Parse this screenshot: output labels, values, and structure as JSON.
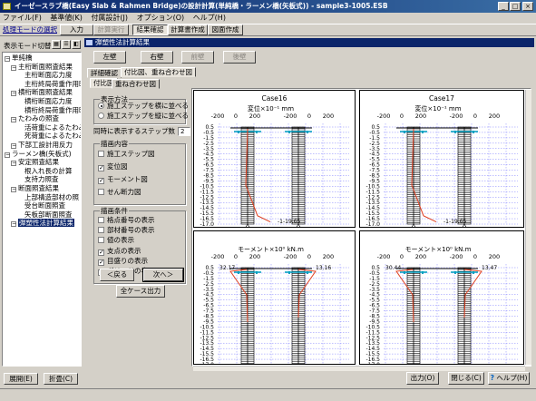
{
  "window": {
    "title": "イーゼースラブ橋(Easy Slab & Rahmen Bridge)の設計計算(単純橋・ラーメン橋(矢板式)) - sample3-1005.ESB",
    "controls": [
      "_",
      "□",
      "×"
    ]
  },
  "menu": [
    "ファイル(F)",
    "基準値(K)",
    "付属設計(J)",
    "オプション(O)",
    "ヘルプ(H)"
  ],
  "toolbar": {
    "mode_label": "処理モードの選択",
    "tabs": [
      "入力",
      "計算実行",
      "結果確認",
      "計算書作成",
      "図面作成"
    ]
  },
  "sidebar": {
    "title": "表示モード切替",
    "tree": [
      {
        "label": "単純橋",
        "indent": 0
      },
      {
        "label": "主桁断面照査結果",
        "indent": 1
      },
      {
        "label": "主桁断面応力度",
        "indent": 2
      },
      {
        "label": "主桁終局荷重作用時",
        "indent": 2
      },
      {
        "label": "横桁断面照査結果",
        "indent": 1
      },
      {
        "label": "横桁断面応力度",
        "indent": 2
      },
      {
        "label": "横桁終局荷重作用時",
        "indent": 2
      },
      {
        "label": "たわみの照査",
        "indent": 1
      },
      {
        "label": "活荷重によるたわみ",
        "indent": 2
      },
      {
        "label": "死荷重によるたわみ",
        "indent": 2
      },
      {
        "label": "下部工設計用反力",
        "indent": 1
      },
      {
        "label": "ラーメン橋(矢板式)",
        "indent": 0
      },
      {
        "label": "安定照査結果",
        "indent": 1
      },
      {
        "label": "根入れ長の計算",
        "indent": 2
      },
      {
        "label": "支持力照査",
        "indent": 2
      },
      {
        "label": "断面照査結果",
        "indent": 1
      },
      {
        "label": "上部構造部材の照",
        "indent": 2
      },
      {
        "label": "受台断面照査",
        "indent": 2
      },
      {
        "label": "矢板部断面照査",
        "indent": 2
      },
      {
        "label": "弾塑性法計算結果",
        "indent": 1
      }
    ],
    "expand_button": "展開(E)",
    "collapse_button": "折畳(C)"
  },
  "panel": {
    "title": "弾塑性法計算結果",
    "nav": {
      "left": "左壁",
      "right": "右壁",
      "prev": "前壁",
      "next": "後壁"
    },
    "tabs": [
      "詳細確認",
      "付比図、重ね合わせ図"
    ],
    "subtabs": [
      "付比図",
      "重ね合わせ図"
    ],
    "display_method": {
      "caption": "表示方法",
      "options": [
        "施工ステップを横に並べる",
        "施工ステップを縦に並べる"
      ],
      "selected": 0
    },
    "steps_label": "同時に表示するステップ数",
    "steps_value": "2",
    "draw_content": {
      "caption": "描画内容",
      "items": [
        {
          "label": "施工ステップ図",
          "checked": false
        },
        {
          "label": "変位図",
          "checked": true
        },
        {
          "label": "モーメント図",
          "checked": true
        },
        {
          "label": "せん断力図",
          "checked": false
        }
      ]
    },
    "draw_conditions": {
      "caption": "描画条件",
      "items": [
        {
          "label": "格点番号の表示",
          "checked": false
        },
        {
          "label": "部材番号の表示",
          "checked": false
        },
        {
          "label": "値の表示",
          "checked": false
        },
        {
          "label": "支点の表示",
          "checked": true
        },
        {
          "label": "目盛りの表示",
          "checked": true
        },
        {
          "label": "グリッドの表示",
          "checked": true
        }
      ]
    },
    "back_button": "＜戻る",
    "next_button": "次へ＞",
    "all_cases_button": "全ケース出力"
  },
  "chart_data": [
    {
      "type": "line",
      "case": "Case16",
      "title": "変位×10⁻¹ mm",
      "xlabel": "",
      "x_ticks": [
        "-200",
        "0",
        "200"
      ],
      "y_ticks": [
        "0.5",
        "-0.5",
        "-1.5",
        "-2.5",
        "-3.5",
        "-4.5",
        "-5.5",
        "-6.5",
        "-7.5",
        "-8.5",
        "-9.5",
        "-10.5",
        "-11.5",
        "-12.5",
        "-13.5",
        "-14.5",
        "-15.5",
        "-16.5",
        "-17.0"
      ],
      "ylim": [
        -17.0,
        0.5
      ],
      "grid": true,
      "annotations": [
        "-1-19.65"
      ],
      "series": [
        {
          "values": [
            0,
            0,
            -5,
            -10,
            -19.65
          ]
        }
      ]
    },
    {
      "type": "line",
      "case": "Case17",
      "title": "変位×10⁻¹ mm",
      "xlabel": "",
      "x_ticks": [
        "-200",
        "0",
        "200"
      ],
      "y_ticks": [
        "0.5",
        "-0.5",
        "-1.5",
        "-2.5",
        "-3.5",
        "-4.5",
        "-5.5",
        "-6.5",
        "-7.5",
        "-8.5",
        "-9.5",
        "-10.5",
        "-11.5",
        "-12.5",
        "-13.5",
        "-14.5",
        "-15.5",
        "-16.5",
        "-17.0"
      ],
      "ylim": [
        -17.0,
        0.5
      ],
      "grid": true,
      "annotations": [
        "-1-19.65"
      ],
      "series": [
        {
          "values": [
            0,
            0,
            -5,
            -10,
            -19.65
          ]
        }
      ]
    },
    {
      "type": "line",
      "case": "Case16",
      "title": "モーメント×10⁰ kN.m",
      "xlabel": "",
      "x_ticks": [
        "-200",
        "0",
        "200"
      ],
      "y_ticks": [
        "0.5",
        "-0.5",
        "-1.5",
        "-2.5",
        "-3.5",
        "-4.5",
        "-5.5",
        "-6.5",
        "-7.5",
        "-8.5",
        "-9.5",
        "-10.5",
        "-11.5",
        "-12.5",
        "-13.5",
        "-14.5",
        "-15.5",
        "-16.5",
        "-17.0"
      ],
      "ylim": [
        -17.0,
        0.5
      ],
      "grid": true,
      "annotations": [
        "32.17",
        "13.16"
      ],
      "series": [
        {
          "values": [
            32.17,
            13.16
          ]
        }
      ]
    },
    {
      "type": "line",
      "case": "Case17",
      "title": "モーメント×10⁰ kN.m",
      "xlabel": "",
      "x_ticks": [
        "-200",
        "0",
        "200"
      ],
      "y_ticks": [
        "0.5",
        "-0.5",
        "-1.5",
        "-2.5",
        "-3.5",
        "-4.5",
        "-5.5",
        "-6.5",
        "-7.5",
        "-8.5",
        "-9.5",
        "-10.5",
        "-11.5",
        "-12.5",
        "-13.5",
        "-14.5",
        "-15.5",
        "-16.5",
        "-17.0"
      ],
      "ylim": [
        -17.0,
        0.5
      ],
      "grid": true,
      "annotations": [
        "30.44",
        "13.47"
      ],
      "series": [
        {
          "values": [
            30.44,
            13.47
          ]
        }
      ]
    }
  ],
  "bottom": {
    "output_button": "出力(O)",
    "close_button": "閉じる(C)",
    "help_button": "ヘルプ(H)"
  },
  "colors": {
    "title_bar": "#0a246a",
    "selection": "#0a246a",
    "curve": "#e04020",
    "grid": "#8080ff",
    "support": "#00a0c0"
  }
}
